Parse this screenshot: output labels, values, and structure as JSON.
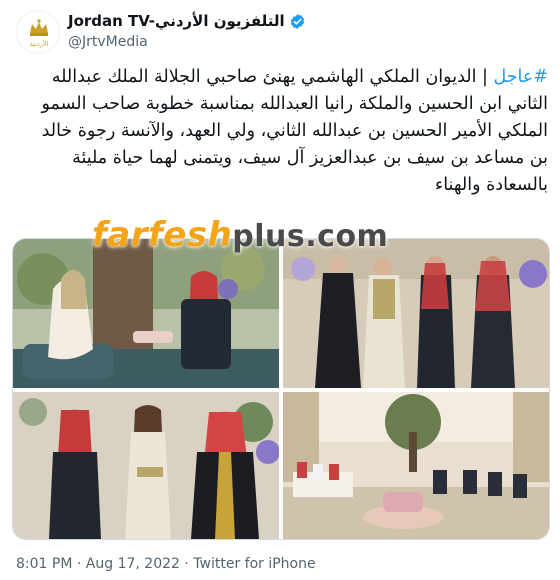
{
  "account": {
    "display_name": "Jordan TV-التلفزيون الأردني",
    "handle": "@JrtvMedia",
    "logo_text": "الأردنية",
    "verified_color": "#1d9bf0"
  },
  "tweet": {
    "hashtag": "#عاجل",
    "body": " | الديوان الملكي الهاشمي يهنئ صاحبي الجلالة الملك عبدالله الثاني ابن الحسين والملكة رانيا العبدالله بمناسبة خطوبة صاحب السمو الملكي الأمير الحسين بن عبدالله الثاني، ولي العهد، والآنسة رجوة خالد بن مساعد بن سيف بن عبدالعزيز آل سيف، ويتمنى لهما حياة مليئة بالسعادة والهناء"
  },
  "watermark": {
    "brand": "farfesh",
    "suffix": "plus.com"
  },
  "photos": [
    {
      "label": "photo-1"
    },
    {
      "label": "photo-2"
    },
    {
      "label": "photo-3"
    },
    {
      "label": "photo-4"
    }
  ],
  "footer": {
    "time": "8:01 PM",
    "separator": " · ",
    "date": "Aug 17, 2022",
    "source": "Twitter for iPhone"
  },
  "colors": {
    "accent": "#1d9bf0",
    "secondary_text": "#536471",
    "watermark_orange": "#f4a418"
  }
}
